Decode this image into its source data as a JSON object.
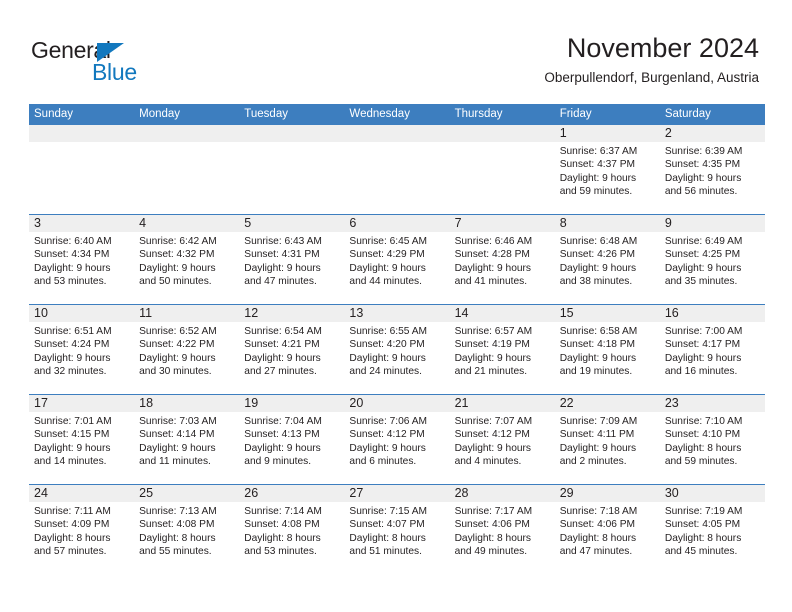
{
  "logo": {
    "word1": "General",
    "word2": "Blue",
    "triangle_color": "#1278be",
    "text_color": "#231f20"
  },
  "header": {
    "title": "November 2024",
    "subtitle": "Oberpullendorf, Burgenland, Austria"
  },
  "theme": {
    "header_blue": "#3d7ebf",
    "daynum_band": "#efefef",
    "text": "#231f20",
    "header_text": "#ffffff"
  },
  "weekdays": [
    "Sunday",
    "Monday",
    "Tuesday",
    "Wednesday",
    "Thursday",
    "Friday",
    "Saturday"
  ],
  "weeks": [
    [
      {
        "day": "",
        "empty": true
      },
      {
        "day": "",
        "empty": true
      },
      {
        "day": "",
        "empty": true
      },
      {
        "day": "",
        "empty": true
      },
      {
        "day": "",
        "empty": true
      },
      {
        "day": "1",
        "sunrise": "Sunrise: 6:37 AM",
        "sunset": "Sunset: 4:37 PM",
        "daylight1": "Daylight: 9 hours",
        "daylight2": "and 59 minutes."
      },
      {
        "day": "2",
        "sunrise": "Sunrise: 6:39 AM",
        "sunset": "Sunset: 4:35 PM",
        "daylight1": "Daylight: 9 hours",
        "daylight2": "and 56 minutes."
      }
    ],
    [
      {
        "day": "3",
        "sunrise": "Sunrise: 6:40 AM",
        "sunset": "Sunset: 4:34 PM",
        "daylight1": "Daylight: 9 hours",
        "daylight2": "and 53 minutes."
      },
      {
        "day": "4",
        "sunrise": "Sunrise: 6:42 AM",
        "sunset": "Sunset: 4:32 PM",
        "daylight1": "Daylight: 9 hours",
        "daylight2": "and 50 minutes."
      },
      {
        "day": "5",
        "sunrise": "Sunrise: 6:43 AM",
        "sunset": "Sunset: 4:31 PM",
        "daylight1": "Daylight: 9 hours",
        "daylight2": "and 47 minutes."
      },
      {
        "day": "6",
        "sunrise": "Sunrise: 6:45 AM",
        "sunset": "Sunset: 4:29 PM",
        "daylight1": "Daylight: 9 hours",
        "daylight2": "and 44 minutes."
      },
      {
        "day": "7",
        "sunrise": "Sunrise: 6:46 AM",
        "sunset": "Sunset: 4:28 PM",
        "daylight1": "Daylight: 9 hours",
        "daylight2": "and 41 minutes."
      },
      {
        "day": "8",
        "sunrise": "Sunrise: 6:48 AM",
        "sunset": "Sunset: 4:26 PM",
        "daylight1": "Daylight: 9 hours",
        "daylight2": "and 38 minutes."
      },
      {
        "day": "9",
        "sunrise": "Sunrise: 6:49 AM",
        "sunset": "Sunset: 4:25 PM",
        "daylight1": "Daylight: 9 hours",
        "daylight2": "and 35 minutes."
      }
    ],
    [
      {
        "day": "10",
        "sunrise": "Sunrise: 6:51 AM",
        "sunset": "Sunset: 4:24 PM",
        "daylight1": "Daylight: 9 hours",
        "daylight2": "and 32 minutes."
      },
      {
        "day": "11",
        "sunrise": "Sunrise: 6:52 AM",
        "sunset": "Sunset: 4:22 PM",
        "daylight1": "Daylight: 9 hours",
        "daylight2": "and 30 minutes."
      },
      {
        "day": "12",
        "sunrise": "Sunrise: 6:54 AM",
        "sunset": "Sunset: 4:21 PM",
        "daylight1": "Daylight: 9 hours",
        "daylight2": "and 27 minutes."
      },
      {
        "day": "13",
        "sunrise": "Sunrise: 6:55 AM",
        "sunset": "Sunset: 4:20 PM",
        "daylight1": "Daylight: 9 hours",
        "daylight2": "and 24 minutes."
      },
      {
        "day": "14",
        "sunrise": "Sunrise: 6:57 AM",
        "sunset": "Sunset: 4:19 PM",
        "daylight1": "Daylight: 9 hours",
        "daylight2": "and 21 minutes."
      },
      {
        "day": "15",
        "sunrise": "Sunrise: 6:58 AM",
        "sunset": "Sunset: 4:18 PM",
        "daylight1": "Daylight: 9 hours",
        "daylight2": "and 19 minutes."
      },
      {
        "day": "16",
        "sunrise": "Sunrise: 7:00 AM",
        "sunset": "Sunset: 4:17 PM",
        "daylight1": "Daylight: 9 hours",
        "daylight2": "and 16 minutes."
      }
    ],
    [
      {
        "day": "17",
        "sunrise": "Sunrise: 7:01 AM",
        "sunset": "Sunset: 4:15 PM",
        "daylight1": "Daylight: 9 hours",
        "daylight2": "and 14 minutes."
      },
      {
        "day": "18",
        "sunrise": "Sunrise: 7:03 AM",
        "sunset": "Sunset: 4:14 PM",
        "daylight1": "Daylight: 9 hours",
        "daylight2": "and 11 minutes."
      },
      {
        "day": "19",
        "sunrise": "Sunrise: 7:04 AM",
        "sunset": "Sunset: 4:13 PM",
        "daylight1": "Daylight: 9 hours",
        "daylight2": "and 9 minutes."
      },
      {
        "day": "20",
        "sunrise": "Sunrise: 7:06 AM",
        "sunset": "Sunset: 4:12 PM",
        "daylight1": "Daylight: 9 hours",
        "daylight2": "and 6 minutes."
      },
      {
        "day": "21",
        "sunrise": "Sunrise: 7:07 AM",
        "sunset": "Sunset: 4:12 PM",
        "daylight1": "Daylight: 9 hours",
        "daylight2": "and 4 minutes."
      },
      {
        "day": "22",
        "sunrise": "Sunrise: 7:09 AM",
        "sunset": "Sunset: 4:11 PM",
        "daylight1": "Daylight: 9 hours",
        "daylight2": "and 2 minutes."
      },
      {
        "day": "23",
        "sunrise": "Sunrise: 7:10 AM",
        "sunset": "Sunset: 4:10 PM",
        "daylight1": "Daylight: 8 hours",
        "daylight2": "and 59 minutes."
      }
    ],
    [
      {
        "day": "24",
        "sunrise": "Sunrise: 7:11 AM",
        "sunset": "Sunset: 4:09 PM",
        "daylight1": "Daylight: 8 hours",
        "daylight2": "and 57 minutes."
      },
      {
        "day": "25",
        "sunrise": "Sunrise: 7:13 AM",
        "sunset": "Sunset: 4:08 PM",
        "daylight1": "Daylight: 8 hours",
        "daylight2": "and 55 minutes."
      },
      {
        "day": "26",
        "sunrise": "Sunrise: 7:14 AM",
        "sunset": "Sunset: 4:08 PM",
        "daylight1": "Daylight: 8 hours",
        "daylight2": "and 53 minutes."
      },
      {
        "day": "27",
        "sunrise": "Sunrise: 7:15 AM",
        "sunset": "Sunset: 4:07 PM",
        "daylight1": "Daylight: 8 hours",
        "daylight2": "and 51 minutes."
      },
      {
        "day": "28",
        "sunrise": "Sunrise: 7:17 AM",
        "sunset": "Sunset: 4:06 PM",
        "daylight1": "Daylight: 8 hours",
        "daylight2": "and 49 minutes."
      },
      {
        "day": "29",
        "sunrise": "Sunrise: 7:18 AM",
        "sunset": "Sunset: 4:06 PM",
        "daylight1": "Daylight: 8 hours",
        "daylight2": "and 47 minutes."
      },
      {
        "day": "30",
        "sunrise": "Sunrise: 7:19 AM",
        "sunset": "Sunset: 4:05 PM",
        "daylight1": "Daylight: 8 hours",
        "daylight2": "and 45 minutes."
      }
    ]
  ]
}
